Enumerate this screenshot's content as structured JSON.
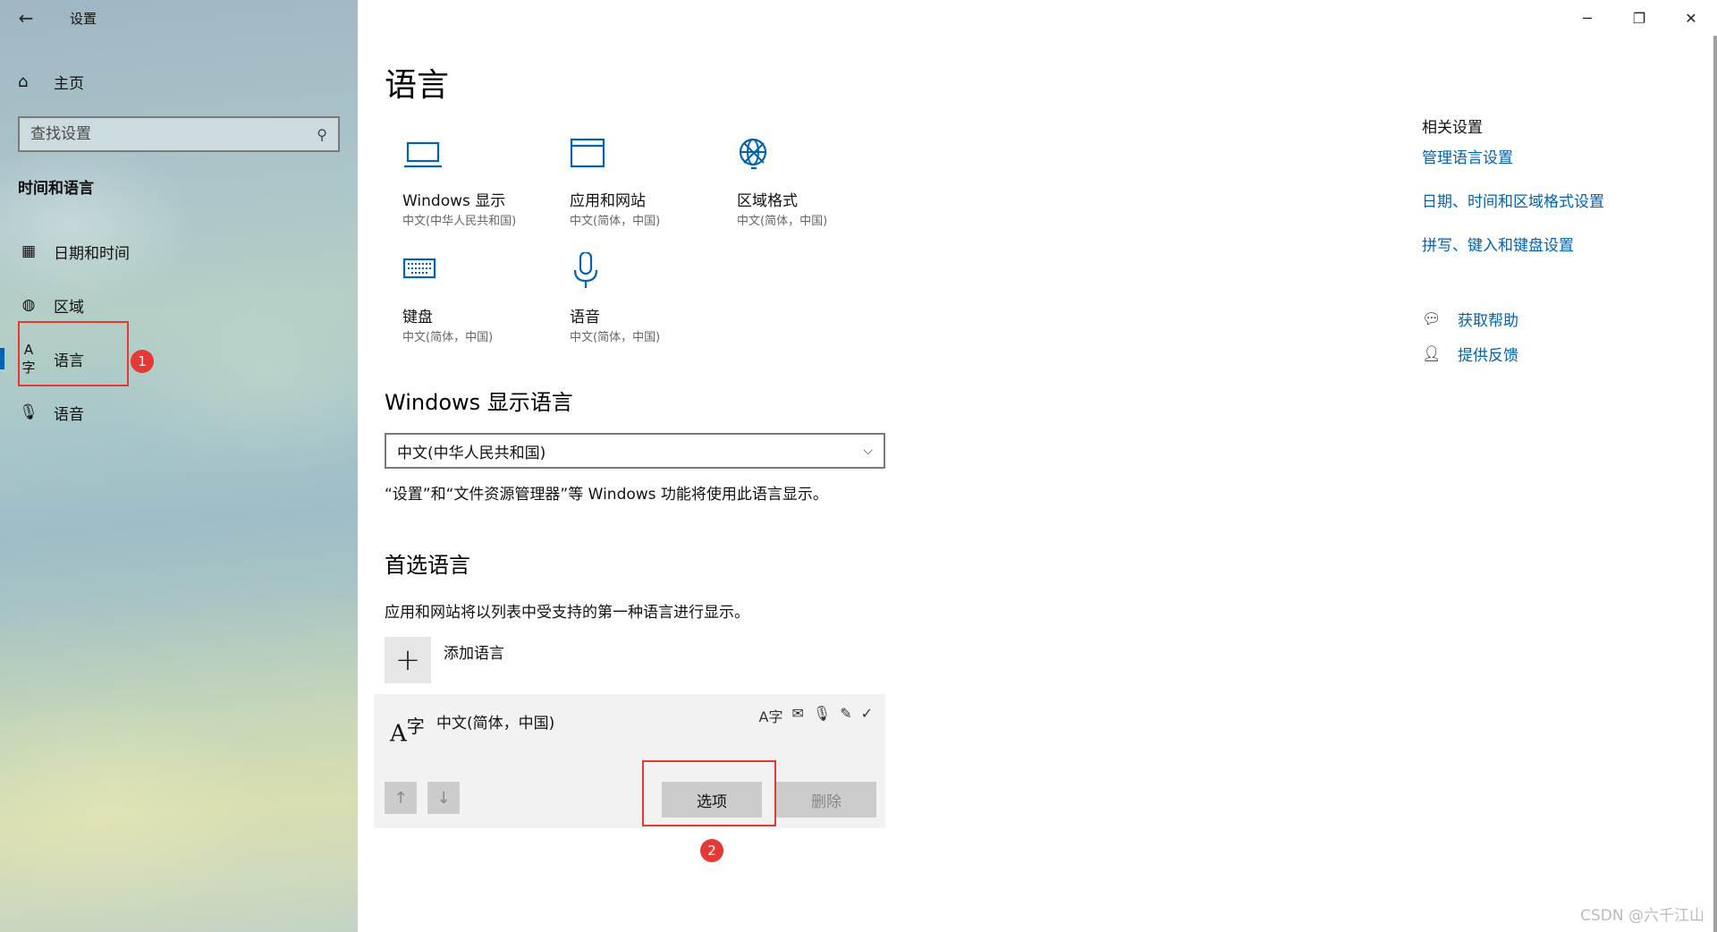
{
  "window": {
    "title": "设置",
    "controls": [
      "minimize",
      "maximize",
      "close"
    ]
  },
  "sidebar": {
    "home_label": "主页",
    "search_placeholder": "查找设置",
    "section_title": "时间和语言",
    "items": [
      {
        "label": "日期和时间",
        "icon": "calendar-clock-icon"
      },
      {
        "label": "区域",
        "icon": "globe-region-icon"
      },
      {
        "label": "语言",
        "icon": "language-icon",
        "active": true
      },
      {
        "label": "语音",
        "icon": "microphone-icon"
      }
    ]
  },
  "main": {
    "title": "语言",
    "tiles": [
      {
        "title": "Windows 显示",
        "subtitle": "中文(中华人民共和国)",
        "icon": "monitor-icon"
      },
      {
        "title": "应用和网站",
        "subtitle": "中文(简体，中国)",
        "icon": "browser-window-icon"
      },
      {
        "title": "区域格式",
        "subtitle": "中文(简体，中国)",
        "icon": "globe-settings-icon"
      },
      {
        "title": "键盘",
        "subtitle": "中文(简体，中国)",
        "icon": "keyboard-icon"
      },
      {
        "title": "语音",
        "subtitle": "中文(简体，中国)",
        "icon": "microphone-icon"
      }
    ],
    "display_language": {
      "heading": "Windows 显示语言",
      "selected": "中文(中华人民共和国)",
      "description": "“设置”和“文件资源管理器”等 Windows 功能将使用此语言显示。"
    },
    "preferred": {
      "heading": "首选语言",
      "description": "应用和网站将以列表中受支持的第一种语言进行显示。",
      "add_label": "添加语言",
      "languages": [
        {
          "name": "中文(简体，中国)",
          "options_label": "选项",
          "remove_label": "删除"
        }
      ]
    }
  },
  "related": {
    "title": "相关设置",
    "links": [
      "管理语言设置",
      "日期、时间和区域格式设置",
      "拼写、键入和键盘设置"
    ],
    "help": "获取帮助",
    "feedback": "提供反馈"
  },
  "annotations": [
    "1",
    "2"
  ],
  "watermark": "CSDN @六千江山",
  "colors": {
    "accent": "#0063b1",
    "annotation": "#e53935"
  }
}
